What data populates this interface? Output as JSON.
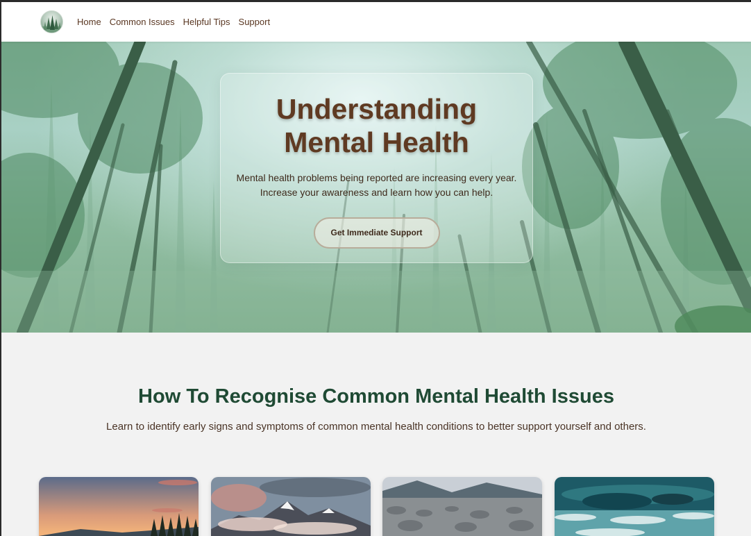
{
  "nav": {
    "logo": "forest-logo",
    "links": [
      "Home",
      "Common Issues",
      "Helpful Tips",
      "Support"
    ]
  },
  "hero": {
    "title_line1": "Understanding",
    "title_line2": "Mental Health",
    "text_line1": "Mental health problems being reported are increasing every year.",
    "text_line2": "Increase your awareness and learn how you can help.",
    "button": "Get Immediate Support"
  },
  "section": {
    "title": "How To Recognise Common Mental Health Issues",
    "subtitle": "Learn to identify early signs and symptoms of common mental health conditions to better support yourself and others."
  },
  "cards": [
    {
      "image": "sunset-forest-image"
    },
    {
      "image": "snowy-mountains-image"
    },
    {
      "image": "pebble-beach-image"
    },
    {
      "image": "ocean-wave-image"
    }
  ],
  "colors": {
    "brown_text": "#5f3a22",
    "green_heading": "#1f4a34",
    "page_bg": "#f2f2f2"
  }
}
